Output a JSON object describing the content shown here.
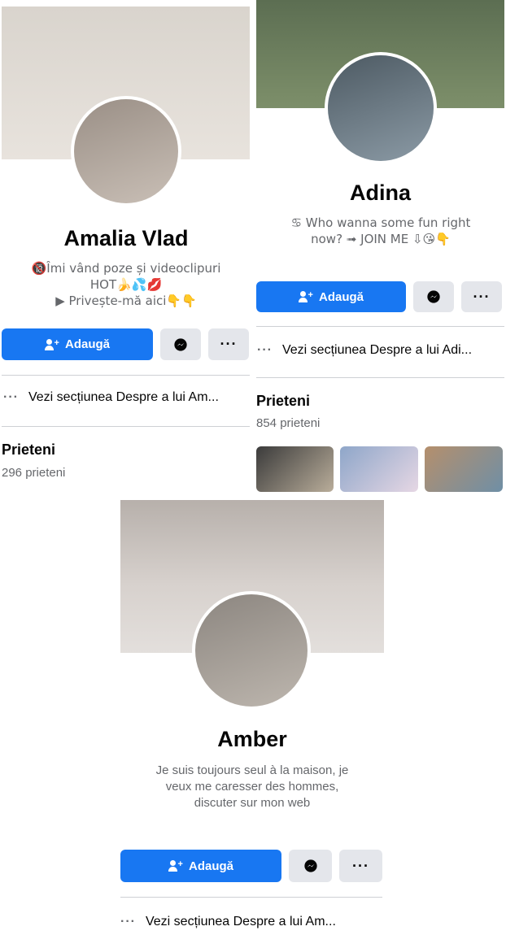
{
  "profiles": [
    {
      "name": "Amalia Vlad",
      "bio_lines": [
        "🔞Îmi vând poze și videoclipuri",
        "HOT🍌💦💋",
        "▶ Privește-mă aici👇👇"
      ],
      "add_label": "Adaugă",
      "about_label": "Vezi secțiunea Despre a lui Am...",
      "friends_title": "Prieteni",
      "friends_count": "296 prieteni"
    },
    {
      "name": "Adina",
      "bio_lines": [
        "♋ Who wanna some fun right",
        "now? ➟ JOIN ME ⇩😘👇"
      ],
      "add_label": "Adaugă",
      "about_label": "Vezi secțiunea Despre a lui Adi...",
      "friends_title": "Prieteni",
      "friends_count": "854 prieteni"
    },
    {
      "name": "Amber",
      "bio_lines": [
        "Je suis toujours seul à la maison, je",
        "veux me caresser des hommes,",
        "discuter sur mon web"
      ],
      "add_label": "Adaugă",
      "about_label": "Vezi secțiunea Despre a lui Am..."
    }
  ],
  "icons": {
    "messenger": "messenger-icon",
    "more": "more-icon",
    "add_friend": "add-friend-icon"
  },
  "colors": {
    "primary_button": "#1877f2",
    "secondary_button": "#e4e6eb",
    "muted_text": "#65676b"
  }
}
